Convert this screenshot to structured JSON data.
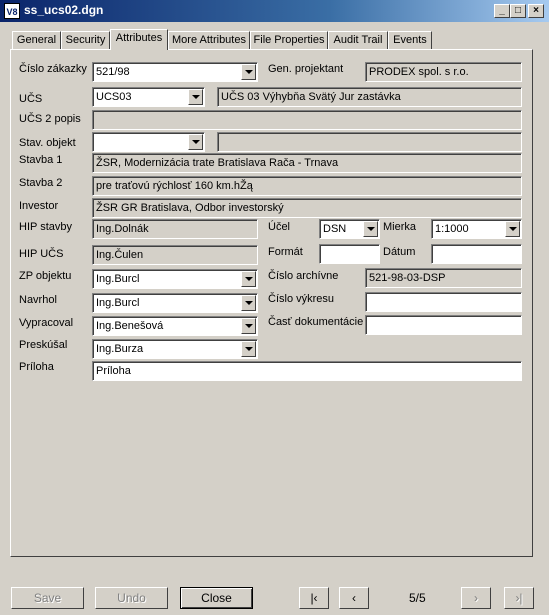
{
  "window": {
    "title": "ss_ucs02.dgn",
    "icon": "app-icon"
  },
  "tabs": [
    {
      "label": "General",
      "active": false
    },
    {
      "label": "Security",
      "active": false
    },
    {
      "label": "Attributes",
      "active": true
    },
    {
      "label": "More Attributes",
      "active": false
    },
    {
      "label": "File Properties",
      "active": false
    },
    {
      "label": "Audit Trail",
      "active": false
    },
    {
      "label": "Events",
      "active": false
    }
  ],
  "form": {
    "cislo_zakazky": {
      "label": "Číslo zákazky",
      "value": "521/98"
    },
    "gen_projektant": {
      "label": "Gen. projektant",
      "value": "PRODEX spol. s r.o."
    },
    "ucs": {
      "label": "UČS",
      "value": "UCS03",
      "desc": "UČS 03 Výhybňa Svätý Jur zastávka"
    },
    "ucs2_popis": {
      "label": "UČS 2 popis",
      "value": ""
    },
    "stav_objekt": {
      "label": "Stav. objekt",
      "value": "",
      "desc": ""
    },
    "stavba1": {
      "label": "Stavba 1",
      "value": "ŽSR, Modernizácia trate Bratislava Rača - Trnava"
    },
    "stavba2": {
      "label": "Stavba 2",
      "value": "pre traťovú rýchlosť 160 km.hŽą"
    },
    "investor": {
      "label": "Investor",
      "value": "ŽSR GR Bratislava, Odbor investorský"
    },
    "hip_stavby": {
      "label": "HIP stavby",
      "value": "Ing.Dolnák"
    },
    "ucel": {
      "label": "Účel",
      "value": "DSN"
    },
    "mierka": {
      "label": "Mierka",
      "value": "1:1000"
    },
    "hip_ucs": {
      "label": "HIP UČS",
      "value": "Ing.Čulen"
    },
    "format": {
      "label": "Formát",
      "value": ""
    },
    "datum": {
      "label": "Dátum",
      "value": ""
    },
    "zp_objektu": {
      "label": "ZP objektu",
      "value": "Ing.Burcl"
    },
    "cislo_archivne": {
      "label": "Číslo archívne",
      "value": "521-98-03-DSP"
    },
    "navrhol": {
      "label": "Navrhol",
      "value": "Ing.Burcl"
    },
    "cislo_vykresu": {
      "label": "Číslo výkresu",
      "value": ""
    },
    "vypracoval": {
      "label": "Vypracoval",
      "value": "Ing.Benešová"
    },
    "cast_dokumentacie": {
      "label": "Časť dokumentácie",
      "value": ""
    },
    "preskusal": {
      "label": "Preskúšal",
      "value": "Ing.Burza"
    },
    "priloha": {
      "label": "Príloha",
      "value": "Príloha"
    }
  },
  "footer": {
    "save": "Save",
    "undo": "Undo",
    "close": "Close",
    "page": "5/5"
  }
}
